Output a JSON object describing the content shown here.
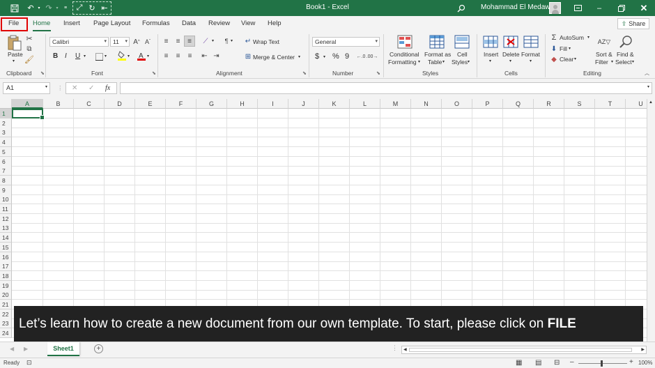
{
  "window": {
    "title": "Book1  -  Excel",
    "user_name": "Mohammad El Medawar"
  },
  "tabs": [
    {
      "label": "File"
    },
    {
      "label": "Home"
    },
    {
      "label": "Insert"
    },
    {
      "label": "Page Layout"
    },
    {
      "label": "Formulas"
    },
    {
      "label": "Data"
    },
    {
      "label": "Review"
    },
    {
      "label": "View"
    },
    {
      "label": "Help"
    }
  ],
  "share_label": "Share",
  "ribbon": {
    "clipboard": {
      "paste": "Paste",
      "group": "Clipboard"
    },
    "font": {
      "name": "Calibri",
      "size": "11",
      "group": "Font",
      "bold": "B",
      "italic": "I",
      "underline": "U"
    },
    "alignment": {
      "wrap": "Wrap Text",
      "merge": "Merge & Center",
      "group": "Alignment"
    },
    "number": {
      "format": "General",
      "currency": "$",
      "percent": "%",
      "comma": "9",
      "group": "Number"
    },
    "styles": {
      "conditional": [
        "Conditional",
        "Formatting"
      ],
      "format_table": [
        "Format as",
        "Table"
      ],
      "cell_styles": [
        "Cell",
        "Styles"
      ],
      "group": "Styles"
    },
    "cells": {
      "insert": "Insert",
      "delete": "Delete",
      "format": "Format",
      "group": "Cells"
    },
    "editing": {
      "autosum": "AutoSum",
      "fill": "Fill",
      "clear": "Clear",
      "sort": [
        "Sort &",
        "Filter"
      ],
      "find": [
        "Find &",
        "Select"
      ],
      "group": "Editing"
    }
  },
  "formula_bar": {
    "name_box": "A1",
    "fx": "fx",
    "value": ""
  },
  "columns": [
    "A",
    "B",
    "C",
    "D",
    "E",
    "F",
    "G",
    "H",
    "I",
    "J",
    "K",
    "L",
    "M",
    "N",
    "O",
    "P",
    "Q",
    "R",
    "S",
    "T",
    "U"
  ],
  "rows": [
    "1",
    "2",
    "3",
    "4",
    "5",
    "6",
    "7",
    "8",
    "9",
    "10",
    "11",
    "12",
    "13",
    "14",
    "15",
    "16",
    "17",
    "18",
    "19",
    "20",
    "21",
    "22",
    "23",
    "24"
  ],
  "caption": {
    "text": "Let’s learn how to create a new document from our own template. To start, please click on ",
    "emphasis": "FILE"
  },
  "sheets": [
    {
      "name": "Sheet1"
    }
  ],
  "status": {
    "ready": "Ready",
    "zoom": "100%"
  },
  "colors": {
    "accent": "#217346",
    "highlight": "#e00000",
    "caption_bg": "#222222"
  }
}
